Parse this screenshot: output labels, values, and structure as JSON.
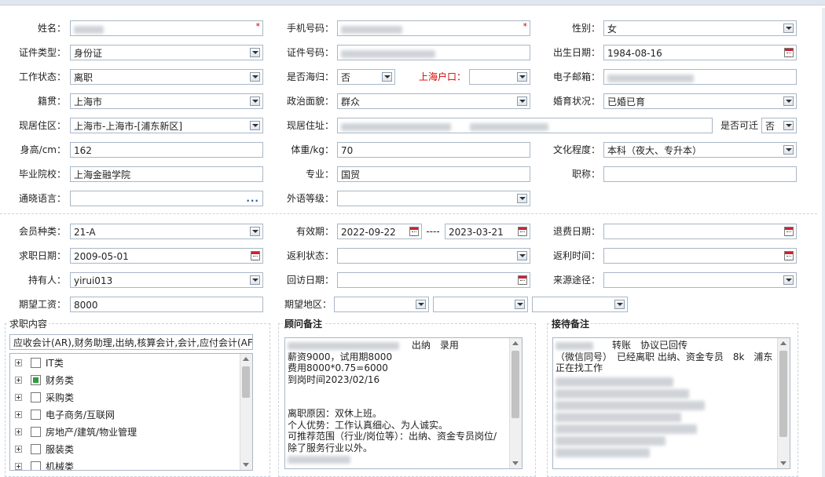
{
  "personal": {
    "name_label": "姓名：",
    "phone_label": "手机号码：",
    "gender_label": "性别：",
    "gender_value": "女",
    "idtype_label": "证件类型：",
    "idtype_value": "身份证",
    "idno_label": "证件号码：",
    "birth_label": "出生日期：",
    "birth_value": "1984-08-16",
    "workstatus_label": "工作状态：",
    "workstatus_value": "离职",
    "returnee_label": "是否海归：",
    "returnee_value": "否",
    "shhukou_label": "上海户口：",
    "email_label": "电子邮箱：",
    "native_label": "籍贯：",
    "native_value": "上海市",
    "political_label": "政治面貌：",
    "political_value": "群众",
    "marital_label": "婚育状况：",
    "marital_value": "已婚已育",
    "residence_area_label": "现居住区：",
    "residence_area_value": "上海市-上海市-[浦东新区]",
    "residence_addr_label": "现居住址：",
    "relocate_label": "是否可迁",
    "relocate_value": "否",
    "height_label": "身高/cm：",
    "height_value": "162",
    "weight_label": "体重/kg：",
    "weight_value": "70",
    "education_label": "文化程度：",
    "education_value": "本科（夜大、专升本）",
    "school_label": "毕业院校：",
    "school_value": "上海金融学院",
    "major_label": "专业：",
    "major_value": "国贸",
    "title_label": "职称：",
    "language_label": "通晓语言：",
    "foreign_level_label": "外语等级："
  },
  "member": {
    "type_label": "会员种类：",
    "type_value": "21-A",
    "validity_label": "有效期：",
    "validity_start": "2022-09-22",
    "validity_sep": "----",
    "validity_end": "2023-03-21",
    "refund_date_label": "退费日期：",
    "jobhunt_date_label": "求职日期：",
    "jobhunt_date_value": "2009-05-01",
    "rebate_status_label": "返利状态：",
    "rebate_time_label": "返利时间：",
    "holder_label": "持有人：",
    "holder_value": "yirui013",
    "visit_date_label": "回访日期：",
    "source_label": "来源途径：",
    "salary_label": "期望工资：",
    "salary_value": "8000",
    "region_label": "期望地区："
  },
  "jobs": {
    "legend": "求职内容",
    "summary": "应收会计(AR),财务助理,出纳,核算会计,会计,应付会计(AF",
    "tree": [
      {
        "label": "IT类",
        "state": "none"
      },
      {
        "label": "财务类",
        "state": "partial"
      },
      {
        "label": "采购类",
        "state": "none"
      },
      {
        "label": "电子商务/互联网",
        "state": "none"
      },
      {
        "label": "房地产/建筑/物业管理",
        "state": "none"
      },
      {
        "label": "服装类",
        "state": "none"
      },
      {
        "label": "机械类",
        "state": "none"
      }
    ]
  },
  "advisor_notes": {
    "legend": "顾问备注",
    "line1_suffix": "出纳　录用",
    "line2": "薪资9000，试用期8000",
    "line3": "费用8000*0.75=6000",
    "line4": "到岗时间2023/02/16",
    "line5": "离职原因：双休上班。",
    "line6": "个人优势：工作认真细心、为人诚实。",
    "line7": "可推荐范围（行业/岗位等）：出纳、资金专员岗位/",
    "line8": "除了服务行业以外。"
  },
  "reception_notes": {
    "legend": "接待备注",
    "line1_suffix": "转账　协议已回传",
    "line2": "（微信同号）　已经离职 出纳、资金专员　8k　浦东",
    "line3": "正在找工作"
  },
  "icons": {
    "dropdown": "chevron-down-icon",
    "calendar": "calendar-icon",
    "ellipsis": "ellipsis-icon",
    "expand": "plus-icon",
    "checkbox": "checkbox-icon"
  },
  "colors": {
    "required": "#d40000",
    "border": "#a9b7c6",
    "check_partial": "#2e9d3a"
  }
}
